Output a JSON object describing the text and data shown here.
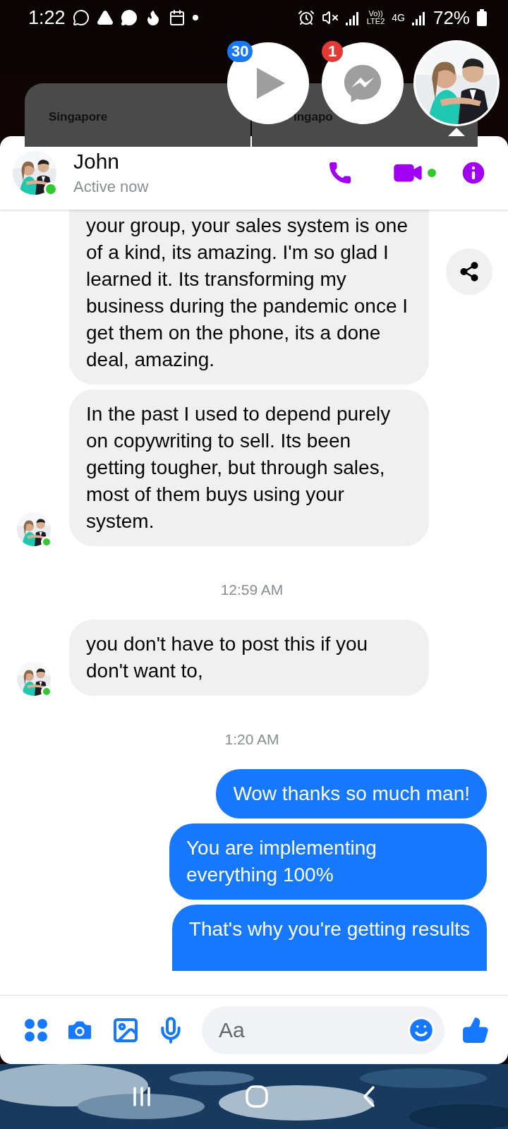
{
  "status_bar": {
    "time": "1:22",
    "network_labels": [
      "Vo))",
      "LTE2",
      "4G"
    ],
    "battery": "72%"
  },
  "widgets": [
    {
      "title": "Singapore"
    },
    {
      "title": "ingapo"
    }
  ],
  "chat_heads": [
    {
      "kind": "video",
      "badge": "30",
      "color": "#1877f2",
      "selected": false
    },
    {
      "kind": "messenger",
      "badge": "1",
      "color": "#e53935",
      "selected": false
    },
    {
      "kind": "contact",
      "selected": true
    }
  ],
  "header": {
    "name": "John",
    "status": "Active now",
    "online": true
  },
  "messages": [
    {
      "kind": "received",
      "text": "your group, your sales system is one of a kind, its amazing. I'm so glad I learned it. Its transforming my business during the pandemic once I get them on the phone, its a done deal,  amazing.",
      "avatar": false,
      "cut_top": true
    },
    {
      "kind": "received",
      "text": "In the past I used to depend purely on copywriting to sell. Its been getting tougher, but through sales, most of them buys using your system.",
      "avatar": true
    },
    {
      "kind": "timestamp",
      "text": "12:59 AM"
    },
    {
      "kind": "received",
      "text": "you don't have to post this if you don't want to,",
      "avatar": true
    },
    {
      "kind": "timestamp",
      "text": "1:20 AM"
    },
    {
      "kind": "sent",
      "text": "Wow thanks so much man!"
    },
    {
      "kind": "sent",
      "text": "You are implementing everything 100%"
    },
    {
      "kind": "sent",
      "text": "That's why you're getting results",
      "cut_bottom": true
    }
  ],
  "composer": {
    "placeholder": "Aa"
  }
}
